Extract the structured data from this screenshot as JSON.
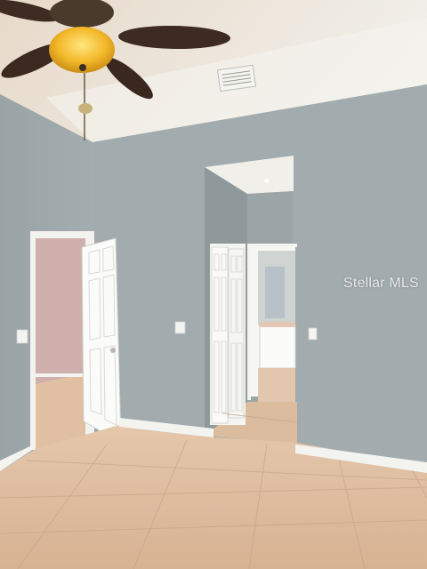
{
  "watermark": {
    "text": "Stellar MLS"
  },
  "scene": {
    "description_colors": {
      "wall": "#9ea8ab",
      "ceiling": "#ecebe4",
      "floor_tile": "#dcb89a",
      "trim": "#f3f3ef",
      "fan_blade": "#3d2a20",
      "fan_light": "#f2b52a"
    }
  }
}
